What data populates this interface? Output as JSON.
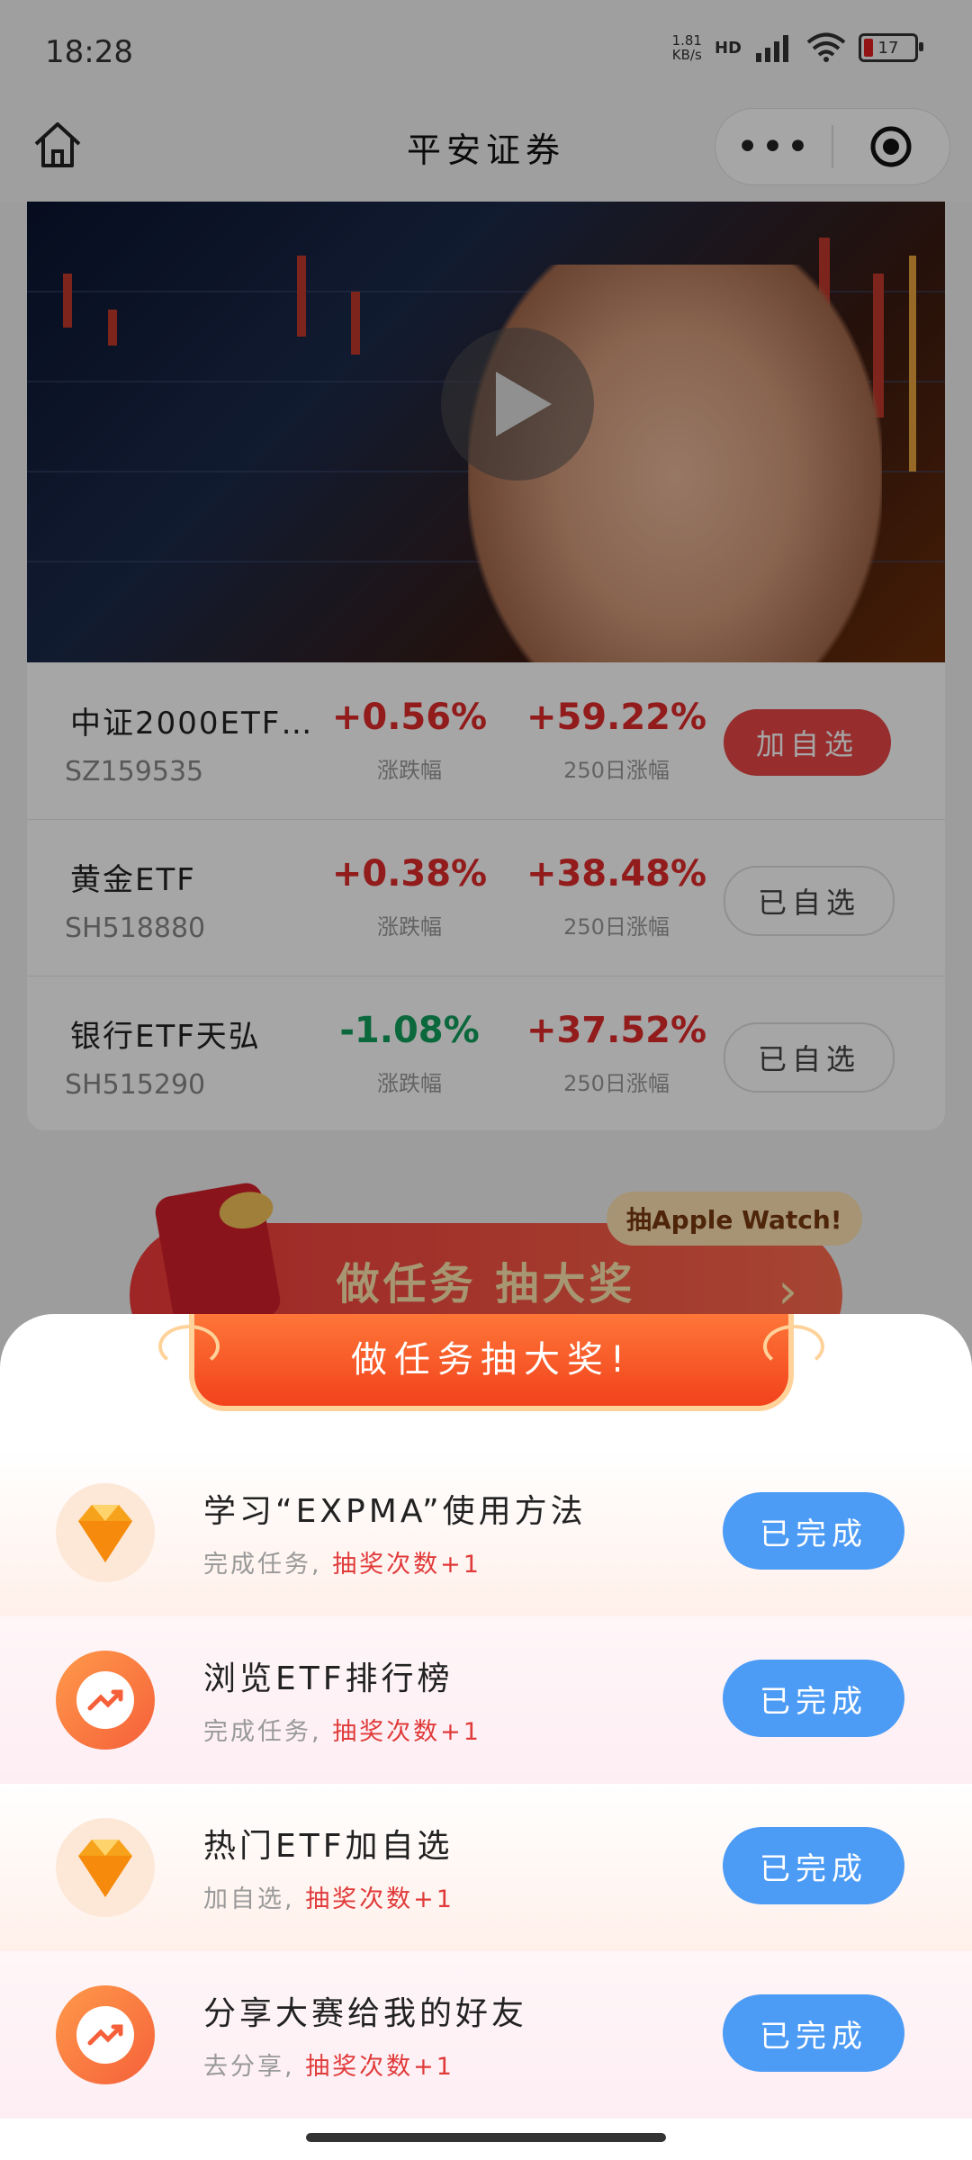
{
  "status": {
    "time": "18:28",
    "net_speed_top": "1.81",
    "net_speed_bottom": "KB/s",
    "hd": "HD",
    "battery": "17"
  },
  "nav": {
    "title": "平安证券",
    "more_icon": "•••",
    "home_icon": "home-icon",
    "target_icon": "target-icon"
  },
  "video": {
    "play_icon": "play-icon"
  },
  "etf_list": [
    {
      "name": "中证2000ETF…",
      "code": "SZ159535",
      "change": "+0.56%",
      "change_label": "涨跌幅",
      "change_250": "+59.22%",
      "change_250_label": "250日涨幅",
      "button": "加自选"
    },
    {
      "name": "黄金ETF",
      "code": "SH518880",
      "change": "+0.38%",
      "change_label": "涨跌幅",
      "change_250": "+38.48%",
      "change_250_label": "250日涨幅",
      "button": "已自选"
    },
    {
      "name": "银行ETF天弘",
      "code": "SH515290",
      "change": "-1.08%",
      "change_label": "涨跌幅",
      "change_250": "+37.52%",
      "change_250_label": "250日涨幅",
      "button": "已自选"
    }
  ],
  "promo": {
    "title": "做任务 抽大奖",
    "tip": "抽Apple Watch!",
    "arrow": "›"
  },
  "sheet": {
    "banner": "做任务抽大奖!",
    "tasks": [
      {
        "title": "学习“EXPMA”使用方法",
        "sub_prefix": "完成任务,",
        "sub_highlight": "抽奖次数+1",
        "button": "已完成",
        "icon": "gem-icon"
      },
      {
        "title": "浏览ETF排行榜",
        "sub_prefix": "完成任务,",
        "sub_highlight": "抽奖次数+1",
        "button": "已完成",
        "icon": "trend-icon"
      },
      {
        "title": "热门ETF加自选",
        "sub_prefix": "加自选,",
        "sub_highlight": "抽奖次数+1",
        "button": "已完成",
        "icon": "gem-icon"
      },
      {
        "title": "分享大赛给我的好友",
        "sub_prefix": "去分享,",
        "sub_highlight": "抽奖次数+1",
        "button": "已完成",
        "icon": "trend-icon"
      }
    ]
  },
  "colors": {
    "up": "#e02a2a",
    "down": "#12a05c",
    "task_button": "#4c9bf5",
    "banner": "#f2421c"
  }
}
